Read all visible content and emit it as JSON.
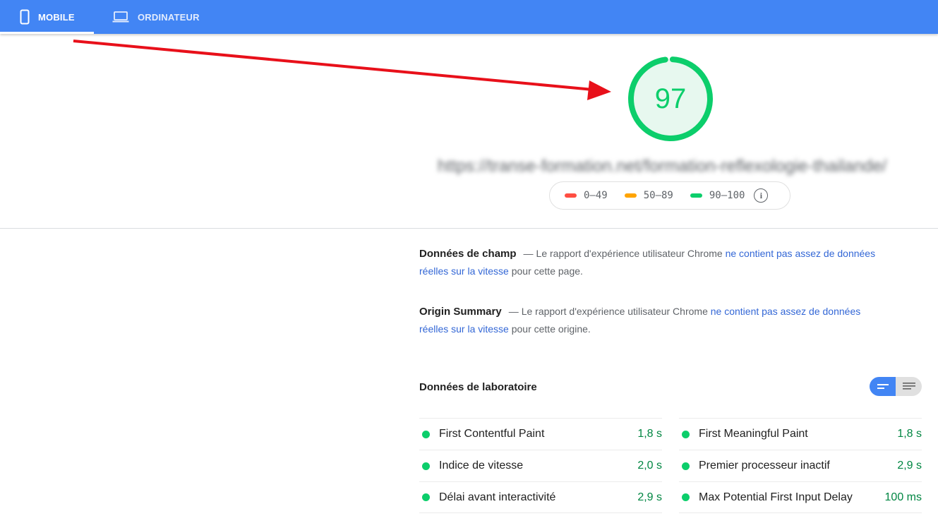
{
  "tabs": {
    "mobile_label": "MOBILE",
    "desktop_label": "ORDINATEUR"
  },
  "score": {
    "value": "97",
    "fraction": 0.97,
    "color": "#0cce6b"
  },
  "url": "https://transe-formation.net/formation-reflexologie-thailande/",
  "legend": {
    "fail": "0–49",
    "average": "50–89",
    "pass": "90–100",
    "colors": {
      "fail": "#ff4e42",
      "average": "#ffa400",
      "pass": "#0cce6b"
    }
  },
  "field_data": {
    "title": "Données de champ",
    "dash": "—",
    "intro": "Le rapport d'expérience utilisateur Chrome ",
    "link": "ne contient pas assez de données réelles sur la vitesse",
    "outro": " pour cette page."
  },
  "origin_summary": {
    "title": "Origin Summary",
    "dash": "—",
    "intro": "Le rapport d'expérience utilisateur Chrome ",
    "link": "ne contient pas assez de données réelles sur la vitesse",
    "outro": " pour cette origine."
  },
  "lab": {
    "title": "Données de laboratoire",
    "left": [
      {
        "name": "First Contentful Paint",
        "value": "1,8 s"
      },
      {
        "name": "Indice de vitesse",
        "value": "2,0 s"
      },
      {
        "name": "Délai avant interactivité",
        "value": "2,9 s"
      }
    ],
    "right": [
      {
        "name": "First Meaningful Paint",
        "value": "1,8 s"
      },
      {
        "name": "Premier processeur inactif",
        "value": "2,9 s"
      },
      {
        "name": "Max Potential First Input Delay",
        "value": "100 ms"
      }
    ]
  },
  "colors": {
    "topbar": "#4285f4",
    "link": "#3367d6",
    "pass_value": "#018642",
    "arrow": "#e8101a"
  }
}
